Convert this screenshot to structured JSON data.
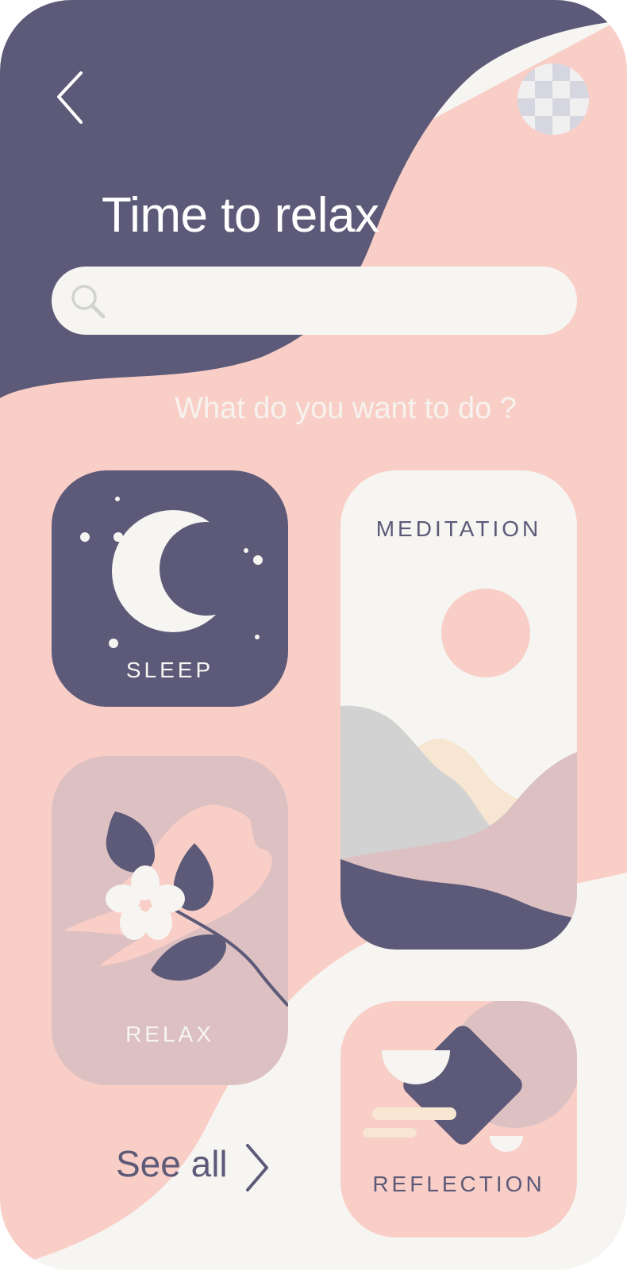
{
  "header": {
    "title": "Time to relax"
  },
  "search": {
    "value": "",
    "placeholder": ""
  },
  "prompt": "What do you want to do ?",
  "categories": {
    "sleep": {
      "label": "SLEEP"
    },
    "meditation": {
      "label": "MEDITATION"
    },
    "relax": {
      "label": "RELAX"
    },
    "reflection": {
      "label": "REFLECTION"
    }
  },
  "see_all": {
    "label": "See all"
  },
  "colors": {
    "navy": "#5c5a78",
    "pink": "#f9cec7",
    "cream": "#f6f5f1",
    "mauve": "#ddc1c2",
    "sand": "#f6e6d2",
    "grey": "#d2d2d2"
  },
  "icons": {
    "back": "chevron-left-icon",
    "search": "search-icon",
    "more": "chevron-right-icon",
    "sleep": "crescent-moon-icon",
    "meditation": "sun-mountains-icon",
    "relax": "flower-leaves-icon",
    "reflection": "diamond-bowl-icon"
  }
}
